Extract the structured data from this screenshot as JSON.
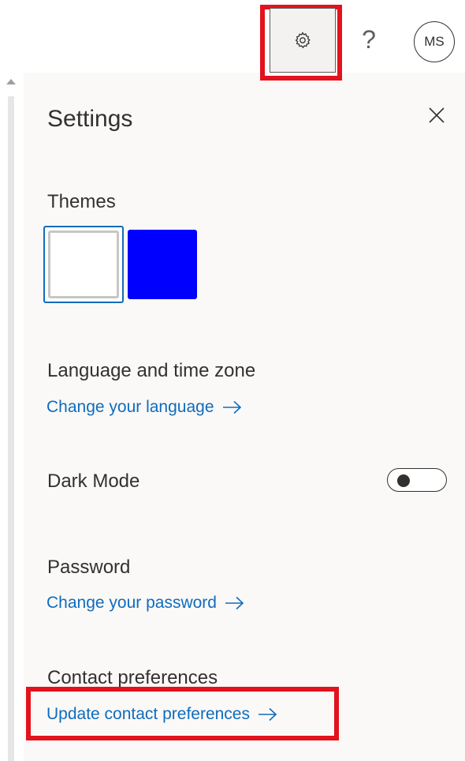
{
  "header": {
    "help_label": "?",
    "avatar_initials": "MS"
  },
  "panel": {
    "title": "Settings",
    "themes": {
      "heading": "Themes",
      "swatch_colors": [
        "#ffffff",
        "#0000ff"
      ],
      "selected_index": 0
    },
    "language": {
      "heading": "Language and time zone",
      "link": "Change your language"
    },
    "dark_mode": {
      "label": "Dark Mode",
      "enabled": false
    },
    "password": {
      "heading": "Password",
      "link": "Change your password"
    },
    "contact": {
      "heading": "Contact preferences",
      "link": "Update contact preferences"
    }
  },
  "colors": {
    "link": "#0f6cbd",
    "highlight": "#e3121d",
    "panel_bg": "#faf9f8",
    "text": "#323130"
  }
}
